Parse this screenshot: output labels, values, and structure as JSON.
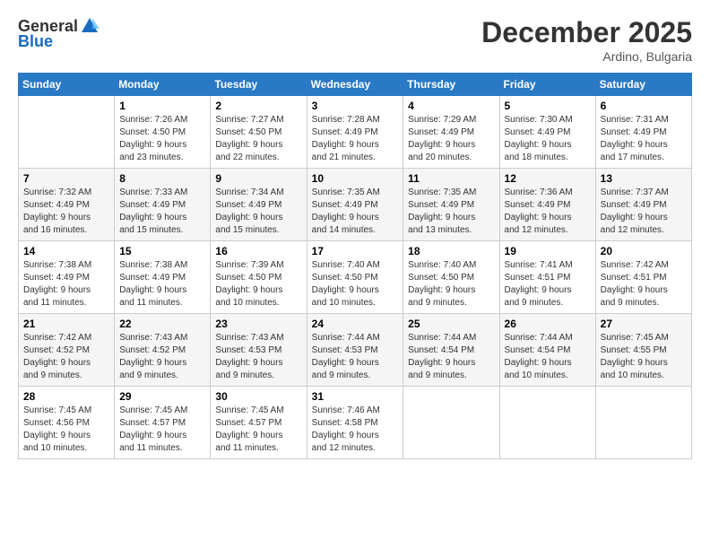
{
  "logo": {
    "general": "General",
    "blue": "Blue"
  },
  "title": "December 2025",
  "location": "Ardino, Bulgaria",
  "weekdays": [
    "Sunday",
    "Monday",
    "Tuesday",
    "Wednesday",
    "Thursday",
    "Friday",
    "Saturday"
  ],
  "weeks": [
    [
      {
        "day": "",
        "info": ""
      },
      {
        "day": "1",
        "info": "Sunrise: 7:26 AM\nSunset: 4:50 PM\nDaylight: 9 hours\nand 23 minutes."
      },
      {
        "day": "2",
        "info": "Sunrise: 7:27 AM\nSunset: 4:50 PM\nDaylight: 9 hours\nand 22 minutes."
      },
      {
        "day": "3",
        "info": "Sunrise: 7:28 AM\nSunset: 4:49 PM\nDaylight: 9 hours\nand 21 minutes."
      },
      {
        "day": "4",
        "info": "Sunrise: 7:29 AM\nSunset: 4:49 PM\nDaylight: 9 hours\nand 20 minutes."
      },
      {
        "day": "5",
        "info": "Sunrise: 7:30 AM\nSunset: 4:49 PM\nDaylight: 9 hours\nand 18 minutes."
      },
      {
        "day": "6",
        "info": "Sunrise: 7:31 AM\nSunset: 4:49 PM\nDaylight: 9 hours\nand 17 minutes."
      }
    ],
    [
      {
        "day": "7",
        "info": "Sunrise: 7:32 AM\nSunset: 4:49 PM\nDaylight: 9 hours\nand 16 minutes."
      },
      {
        "day": "8",
        "info": "Sunrise: 7:33 AM\nSunset: 4:49 PM\nDaylight: 9 hours\nand 15 minutes."
      },
      {
        "day": "9",
        "info": "Sunrise: 7:34 AM\nSunset: 4:49 PM\nDaylight: 9 hours\nand 15 minutes."
      },
      {
        "day": "10",
        "info": "Sunrise: 7:35 AM\nSunset: 4:49 PM\nDaylight: 9 hours\nand 14 minutes."
      },
      {
        "day": "11",
        "info": "Sunrise: 7:35 AM\nSunset: 4:49 PM\nDaylight: 9 hours\nand 13 minutes."
      },
      {
        "day": "12",
        "info": "Sunrise: 7:36 AM\nSunset: 4:49 PM\nDaylight: 9 hours\nand 12 minutes."
      },
      {
        "day": "13",
        "info": "Sunrise: 7:37 AM\nSunset: 4:49 PM\nDaylight: 9 hours\nand 12 minutes."
      }
    ],
    [
      {
        "day": "14",
        "info": "Sunrise: 7:38 AM\nSunset: 4:49 PM\nDaylight: 9 hours\nand 11 minutes."
      },
      {
        "day": "15",
        "info": "Sunrise: 7:38 AM\nSunset: 4:49 PM\nDaylight: 9 hours\nand 11 minutes."
      },
      {
        "day": "16",
        "info": "Sunrise: 7:39 AM\nSunset: 4:50 PM\nDaylight: 9 hours\nand 10 minutes."
      },
      {
        "day": "17",
        "info": "Sunrise: 7:40 AM\nSunset: 4:50 PM\nDaylight: 9 hours\nand 10 minutes."
      },
      {
        "day": "18",
        "info": "Sunrise: 7:40 AM\nSunset: 4:50 PM\nDaylight: 9 hours\nand 9 minutes."
      },
      {
        "day": "19",
        "info": "Sunrise: 7:41 AM\nSunset: 4:51 PM\nDaylight: 9 hours\nand 9 minutes."
      },
      {
        "day": "20",
        "info": "Sunrise: 7:42 AM\nSunset: 4:51 PM\nDaylight: 9 hours\nand 9 minutes."
      }
    ],
    [
      {
        "day": "21",
        "info": "Sunrise: 7:42 AM\nSunset: 4:52 PM\nDaylight: 9 hours\nand 9 minutes."
      },
      {
        "day": "22",
        "info": "Sunrise: 7:43 AM\nSunset: 4:52 PM\nDaylight: 9 hours\nand 9 minutes."
      },
      {
        "day": "23",
        "info": "Sunrise: 7:43 AM\nSunset: 4:53 PM\nDaylight: 9 hours\nand 9 minutes."
      },
      {
        "day": "24",
        "info": "Sunrise: 7:44 AM\nSunset: 4:53 PM\nDaylight: 9 hours\nand 9 minutes."
      },
      {
        "day": "25",
        "info": "Sunrise: 7:44 AM\nSunset: 4:54 PM\nDaylight: 9 hours\nand 9 minutes."
      },
      {
        "day": "26",
        "info": "Sunrise: 7:44 AM\nSunset: 4:54 PM\nDaylight: 9 hours\nand 10 minutes."
      },
      {
        "day": "27",
        "info": "Sunrise: 7:45 AM\nSunset: 4:55 PM\nDaylight: 9 hours\nand 10 minutes."
      }
    ],
    [
      {
        "day": "28",
        "info": "Sunrise: 7:45 AM\nSunset: 4:56 PM\nDaylight: 9 hours\nand 10 minutes."
      },
      {
        "day": "29",
        "info": "Sunrise: 7:45 AM\nSunset: 4:57 PM\nDaylight: 9 hours\nand 11 minutes."
      },
      {
        "day": "30",
        "info": "Sunrise: 7:45 AM\nSunset: 4:57 PM\nDaylight: 9 hours\nand 11 minutes."
      },
      {
        "day": "31",
        "info": "Sunrise: 7:46 AM\nSunset: 4:58 PM\nDaylight: 9 hours\nand 12 minutes."
      },
      {
        "day": "",
        "info": ""
      },
      {
        "day": "",
        "info": ""
      },
      {
        "day": "",
        "info": ""
      }
    ]
  ]
}
